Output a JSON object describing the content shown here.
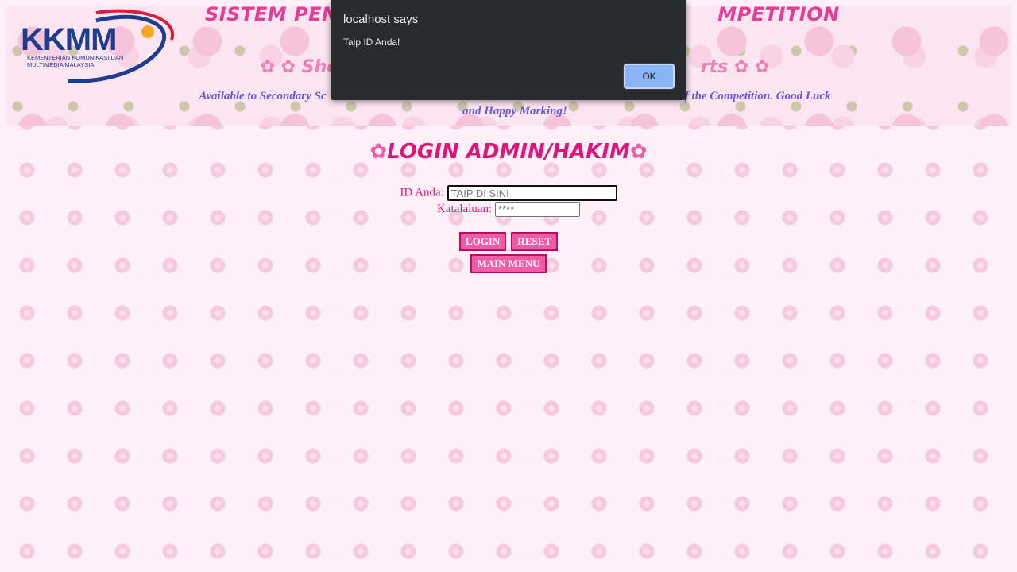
{
  "banner": {
    "logo_text": "KKMM",
    "logo_subtitle": "KEMENTERIAN KOMUNIKASI DAN MULTIMEDIA MALAYSIA",
    "title_left": "SISTEM PEN",
    "title_right": "MPETITION",
    "subtitle_left": "✿ ✿ Sho",
    "subtitle_right": "rts ✿ ✿",
    "description": "Available to Secondary Sc                                                                  eations are Allowed at the Date of the Competition. Good Luck and Happy Marking!"
  },
  "login": {
    "heading": "LOGIN ADMIN/HAKIM",
    "flower_icon": "✿",
    "id_label": "ID Anda:",
    "id_placeholder": "TAIP DI SINI",
    "password_label": "Katalaluan:",
    "password_placeholder": "****",
    "login_button": "LOGIN",
    "reset_button": "RESET",
    "main_menu_button": "MAIN MENU"
  },
  "alert": {
    "title": "localhost says",
    "message": "Taip ID Anda!",
    "ok_label": "OK"
  },
  "colors": {
    "accent_pink": "#e0157b",
    "button_pink": "#ef5ba7",
    "alert_bg": "#292a2d",
    "alert_button": "#8ab4f8"
  }
}
